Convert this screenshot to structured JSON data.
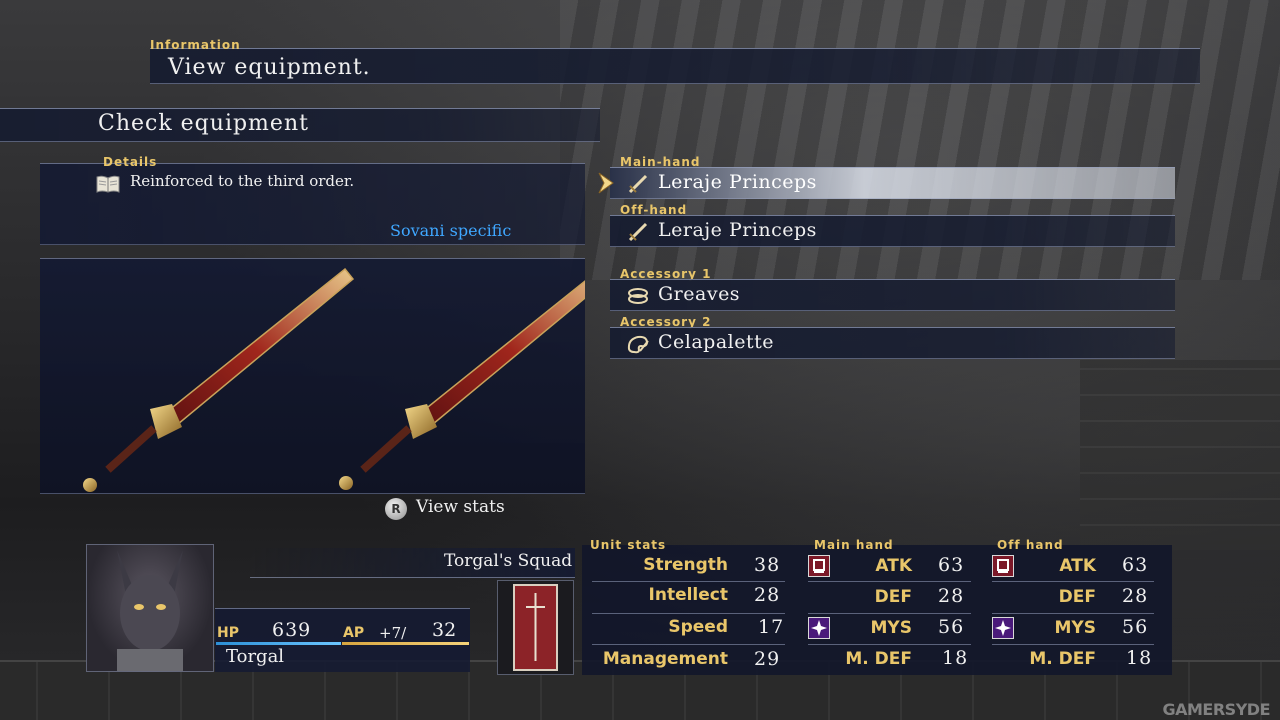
{
  "information": {
    "label": "Information",
    "text": "View equipment."
  },
  "screen": {
    "title": "Check equipment"
  },
  "details": {
    "label": "Details",
    "description": "Reinforced to the third order.",
    "restriction": "Sovani specific"
  },
  "view_stats": {
    "button_glyph": "R",
    "label": "View stats"
  },
  "equipment": {
    "slots": [
      {
        "label": "Main-hand",
        "item": "Leraje Princeps",
        "icon": "sword-icon",
        "selected": true
      },
      {
        "label": "Off-hand",
        "item": "Leraje Princeps",
        "icon": "sword-icon",
        "selected": false
      },
      {
        "label": "Accessory 1",
        "item": "Greaves",
        "icon": "greaves-icon",
        "selected": false
      },
      {
        "label": "Accessory 2",
        "item": "Celapalette",
        "icon": "palette-icon",
        "selected": false
      }
    ]
  },
  "unit": {
    "squad": "Torgal's Squad",
    "name": "Torgal",
    "hp_label": "HP",
    "hp": "639",
    "ap_label": "AP",
    "ap_bonus": "+7/",
    "ap": "32"
  },
  "stats": {
    "unit_label": "Unit stats",
    "main_label": "Main hand",
    "off_label": "Off hand",
    "unit_rows": [
      {
        "name": "Strength",
        "value": "38"
      },
      {
        "name": "Intellect",
        "value": "28"
      },
      {
        "name": "Speed",
        "value": "17"
      },
      {
        "name": "Management",
        "value": "29"
      }
    ],
    "main_rows": [
      {
        "name": "ATK",
        "value": "63",
        "badge": "atk-badge-icon"
      },
      {
        "name": "DEF",
        "value": "28",
        "badge": ""
      },
      {
        "name": "MYS",
        "value": "56",
        "badge": "mys-badge-icon"
      },
      {
        "name": "M. DEF",
        "value": "18",
        "badge": ""
      }
    ],
    "off_rows": [
      {
        "name": "ATK",
        "value": "63",
        "badge": "atk-badge-icon"
      },
      {
        "name": "DEF",
        "value": "28",
        "badge": ""
      },
      {
        "name": "MYS",
        "value": "56",
        "badge": "mys-badge-icon"
      },
      {
        "name": "M. DEF",
        "value": "18",
        "badge": ""
      }
    ]
  },
  "watermark": "GAMERSYDE",
  "colors": {
    "gold_label": "#e9c66a",
    "blue_text": "#3fa7ff",
    "panel": "#161c30"
  }
}
